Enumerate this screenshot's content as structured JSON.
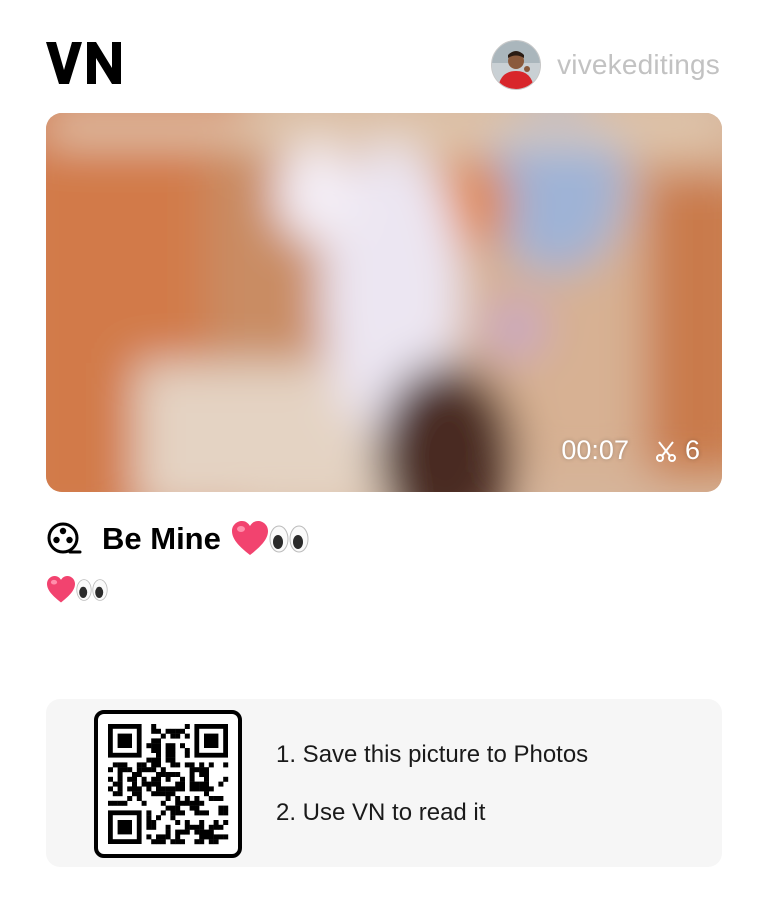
{
  "header": {
    "logo_text": "VN",
    "username": "vivekeditings",
    "avatar": "user-avatar"
  },
  "video": {
    "duration": "00:07",
    "clip_count": "6",
    "clip_icon": "scissors-icon"
  },
  "project": {
    "title_icon": "film-reel-icon",
    "title": "Be Mine",
    "title_emojis": [
      "pink-heart-emoji",
      "eyes-emoji"
    ],
    "description_emojis": [
      "pink-heart-emoji",
      "eyes-emoji"
    ]
  },
  "qr": {
    "step_1": "1. Save this picture to Photos",
    "step_2": "2. Use VN to read it"
  },
  "colors": {
    "username": "#c2c2c2",
    "card_bg": "#f6f6f6",
    "heart": "#f2436f"
  }
}
